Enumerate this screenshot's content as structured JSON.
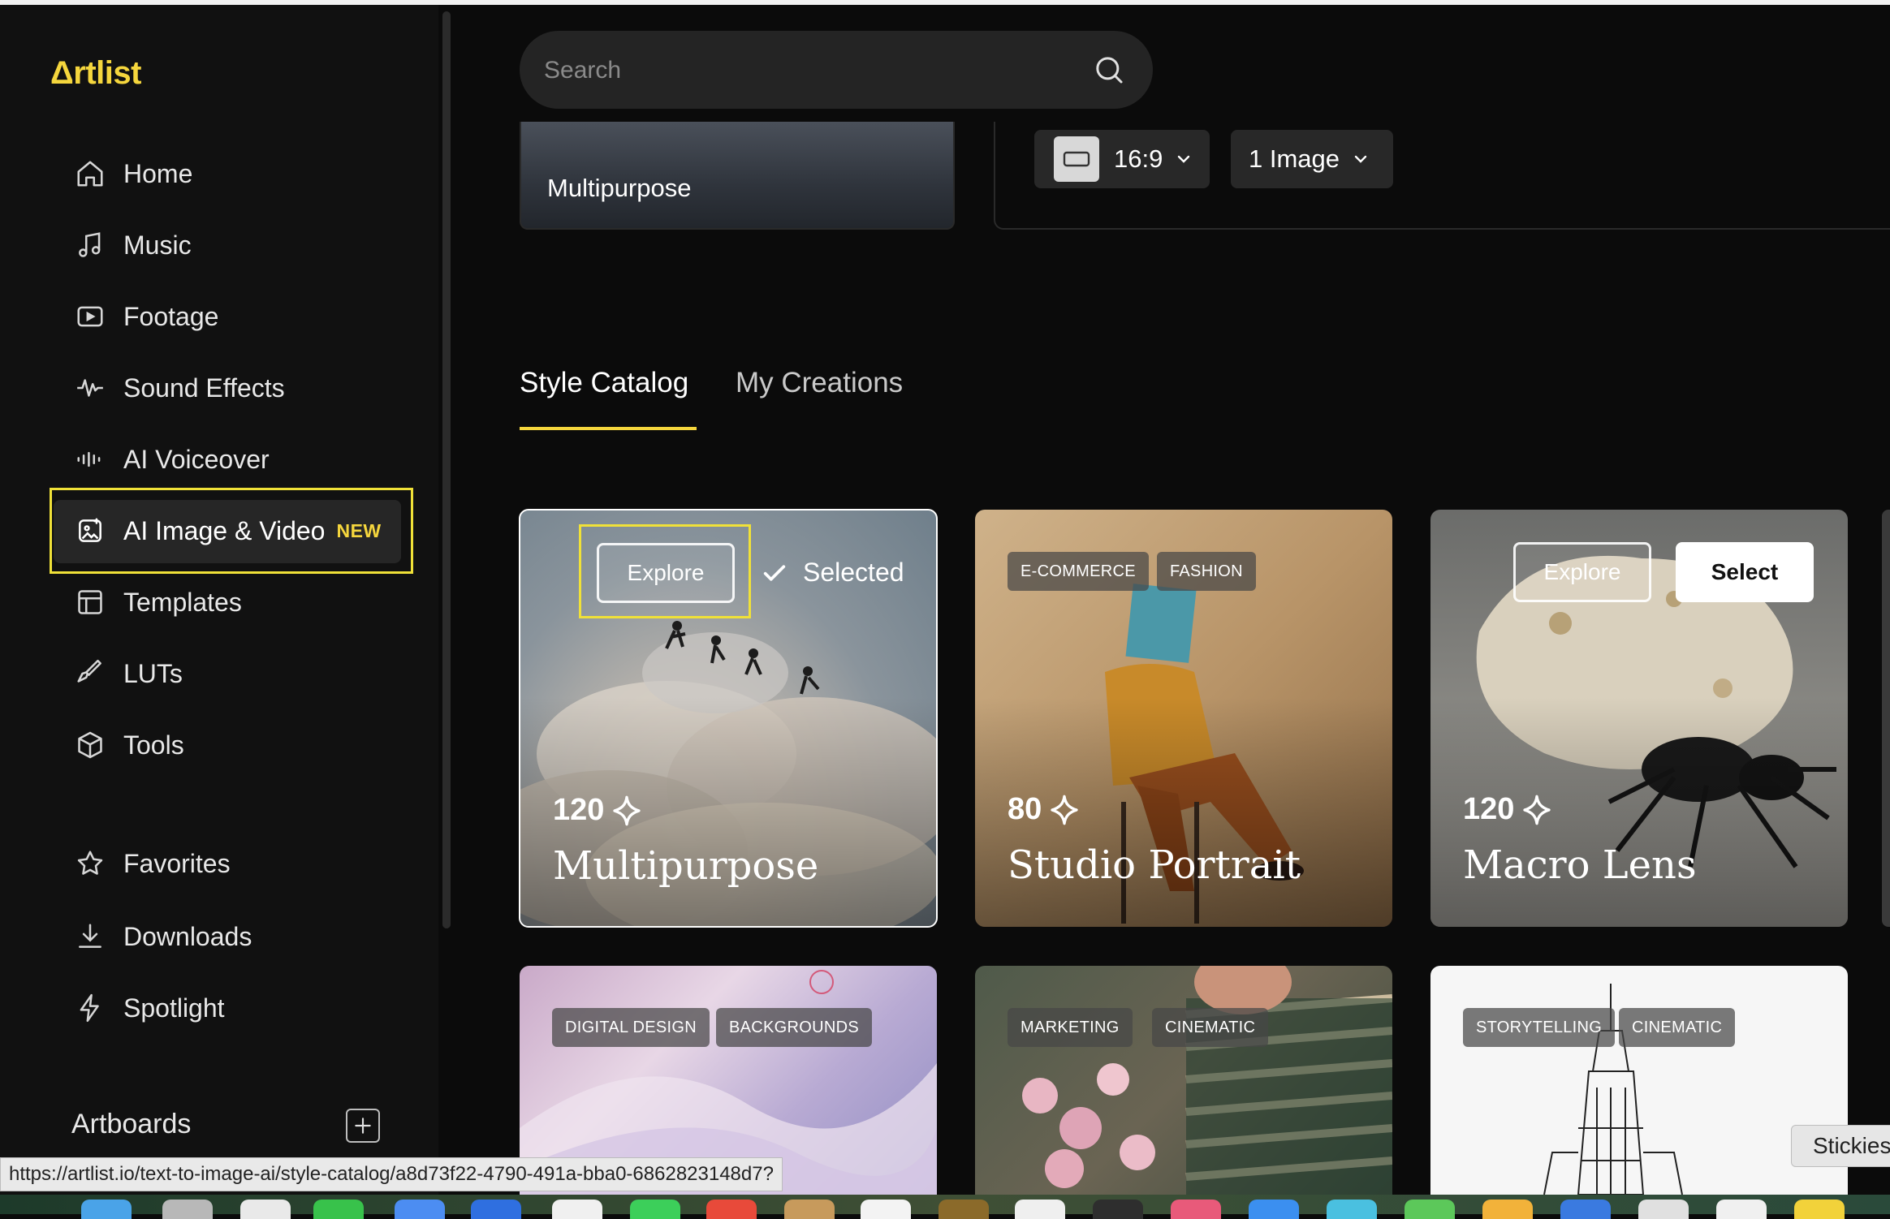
{
  "sidebar": {
    "logo": "Δrtlist",
    "items": [
      {
        "label": "Home",
        "icon": "home-icon"
      },
      {
        "label": "Music",
        "icon": "music-note-icon"
      },
      {
        "label": "Footage",
        "icon": "play-icon"
      },
      {
        "label": "Sound Effects",
        "icon": "waveform-icon"
      },
      {
        "label": "AI Voiceover",
        "icon": "voice-bars-icon"
      },
      {
        "label": "AI Image & Video",
        "icon": "ai-image-icon",
        "badge": "NEW",
        "active": true
      },
      {
        "label": "Templates",
        "icon": "template-icon"
      },
      {
        "label": "LUTs",
        "icon": "brush-icon"
      },
      {
        "label": "Tools",
        "icon": "box-icon"
      }
    ],
    "secondary": [
      {
        "label": "Favorites",
        "icon": "star-icon"
      },
      {
        "label": "Downloads",
        "icon": "download-icon"
      },
      {
        "label": "Spotlight",
        "icon": "lightning-icon"
      }
    ],
    "artboards_label": "Artboards"
  },
  "search": {
    "placeholder": "Search"
  },
  "generator": {
    "current_style": "Multipurpose",
    "aspect_ratio": "16:9",
    "image_count": "1 Image"
  },
  "tabs": [
    {
      "label": "Style Catalog",
      "active": true
    },
    {
      "label": "My Creations",
      "active": false
    }
  ],
  "cards": [
    {
      "title": "Multipurpose",
      "credits": "120",
      "explore": "Explore",
      "selected": "Selected"
    },
    {
      "title": "Studio Portrait",
      "credits": "80",
      "tags": [
        "E-COMMERCE",
        "FASHION"
      ]
    },
    {
      "title": "Macro Lens",
      "credits": "120",
      "explore": "Explore",
      "select": "Select"
    },
    {
      "tags": [
        "DIGITAL DESIGN",
        "BACKGROUNDS"
      ]
    },
    {
      "tags": [
        "MARKETING",
        "CINEMATIC"
      ]
    },
    {
      "tags": [
        "STORYTELLING",
        "CINEMATIC"
      ]
    }
  ],
  "status_url": "https://artlist.io/text-to-image-ai/style-catalog/a8d73f22-4790-491a-bba0-6862823148d7?",
  "stickies_tooltip": "Stickies",
  "colors": {
    "accent": "#f5d63d",
    "background": "#0b0b0b",
    "sidebar": "#111111"
  }
}
